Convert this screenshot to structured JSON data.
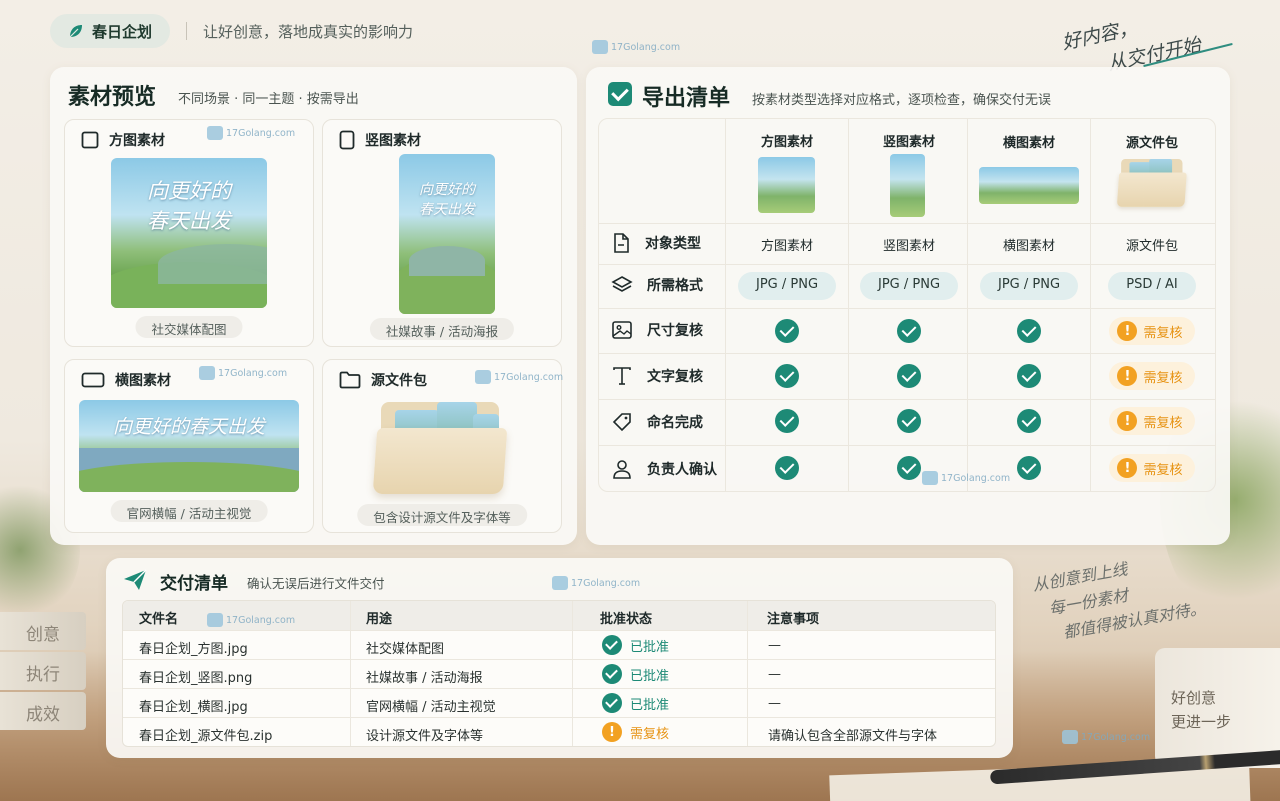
{
  "brand": {
    "label": "春日企划"
  },
  "tagline": "让好创意，落地成真实的影响力",
  "handwriting": {
    "top": [
      "好内容，",
      "从交付开始"
    ],
    "middle": [
      "从创意到上线",
      "每一份素材",
      "都值得被认真对待。"
    ]
  },
  "decor": {
    "books": [
      "创意",
      "执行",
      "成效"
    ],
    "cup": [
      "好创意",
      "更进一步"
    ]
  },
  "watermark": "17Golang.com",
  "preview": {
    "title": "素材预览",
    "subtitle": "不同场景 · 同一主题 · 按需导出",
    "cards": [
      {
        "label": "方图素材",
        "icon": "square-icon",
        "caption": "社交媒体配图",
        "art_text": [
          "向更好的",
          "春天出发"
        ]
      },
      {
        "label": "竖图素材",
        "icon": "portrait-icon",
        "caption": "社媒故事 / 活动海报",
        "art_text": [
          "向更好的",
          "春天出发"
        ]
      },
      {
        "label": "横图素材",
        "icon": "landscape-icon",
        "caption": "官网横幅 / 活动主视觉",
        "art_text": [
          "向更好的春天出发"
        ]
      },
      {
        "label": "源文件包",
        "icon": "folder-icon",
        "caption": "包含设计源文件及字体等"
      }
    ]
  },
  "export": {
    "title": "导出清单",
    "subtitle": "按素材类型选择对应格式，逐项检查，确保交付无误",
    "columns": [
      "方图素材",
      "竖图素材",
      "横图素材",
      "源文件包"
    ],
    "rows": [
      {
        "label": "对象类型",
        "icon": "file-icon",
        "cells": [
          "方图素材",
          "竖图素材",
          "横图素材",
          "源文件包"
        ]
      },
      {
        "label": "所需格式",
        "icon": "layers-icon",
        "cells": [
          "JPG / PNG",
          "JPG / PNG",
          "JPG / PNG",
          "PSD / AI"
        ]
      },
      {
        "label": "尺寸复核",
        "icon": "image-icon",
        "cells": [
          "ok",
          "ok",
          "ok",
          "需复核"
        ]
      },
      {
        "label": "文字复核",
        "icon": "text-icon",
        "cells": [
          "ok",
          "ok",
          "ok",
          "需复核"
        ]
      },
      {
        "label": "命名完成",
        "icon": "tag-icon",
        "cells": [
          "ok",
          "ok",
          "ok",
          "需复核"
        ]
      },
      {
        "label": "负责人确认",
        "icon": "user-icon",
        "cells": [
          "ok",
          "ok",
          "ok",
          "需复核"
        ]
      }
    ]
  },
  "delivery": {
    "title": "交付清单",
    "subtitle": "确认无误后进行文件交付",
    "headers": [
      "文件名",
      "用途",
      "批准状态",
      "注意事项"
    ],
    "rows": [
      {
        "file": "春日企划_方图.jpg",
        "usage": "社交媒体配图",
        "status": "已批准",
        "state": "ok",
        "note": "—"
      },
      {
        "file": "春日企划_竖图.png",
        "usage": "社媒故事 / 活动海报",
        "status": "已批准",
        "state": "ok",
        "note": "—"
      },
      {
        "file": "春日企划_横图.jpg",
        "usage": "官网横幅 / 活动主视觉",
        "status": "已批准",
        "state": "ok",
        "note": "—"
      },
      {
        "file": "春日企划_源文件包.zip",
        "usage": "设计源文件及字体等",
        "status": "需复核",
        "state": "warn",
        "note": "请确认包含全部源文件与字体"
      }
    ]
  },
  "colors": {
    "accent": "#1d8a76",
    "warn": "#f2a122",
    "brand_bg": "#e3e9e2"
  }
}
